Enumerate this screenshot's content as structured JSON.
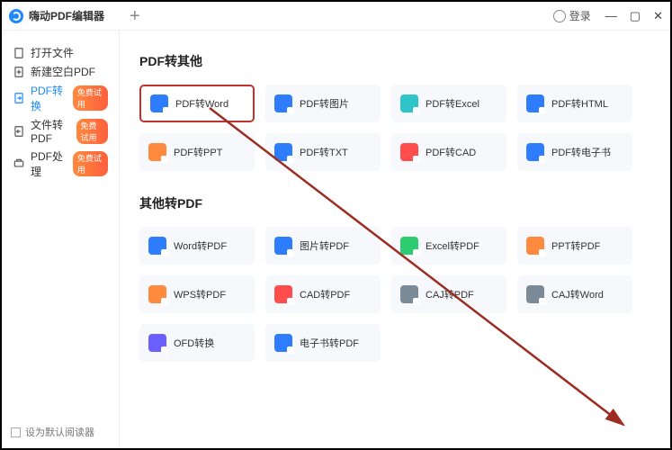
{
  "app": {
    "title": "嗨动PDF编辑器"
  },
  "titlebar": {
    "login": "登录"
  },
  "sidebar": {
    "items": [
      {
        "label": "打开文件",
        "active": false,
        "badge": ""
      },
      {
        "label": "新建空白PDF",
        "active": false,
        "badge": ""
      },
      {
        "label": "PDF转换",
        "active": true,
        "badge": "免费试用"
      },
      {
        "label": "文件转PDF",
        "active": false,
        "badge": "免费试用"
      },
      {
        "label": "PDF处理",
        "active": false,
        "badge": "免费试用"
      }
    ],
    "default_reader": "设为默认阅读器"
  },
  "sections": [
    {
      "title": "PDF转其他",
      "tools": [
        {
          "label": "PDF转Word",
          "color": "ic-blue",
          "highlighted": true
        },
        {
          "label": "PDF转图片",
          "color": "ic-blue"
        },
        {
          "label": "PDF转Excel",
          "color": "ic-cyan"
        },
        {
          "label": "PDF转HTML",
          "color": "ic-blue"
        },
        {
          "label": "PDF转PPT",
          "color": "ic-orange"
        },
        {
          "label": "PDF转TXT",
          "color": "ic-blue"
        },
        {
          "label": "PDF转CAD",
          "color": "ic-red"
        },
        {
          "label": "PDF转电子书",
          "color": "ic-blue"
        }
      ]
    },
    {
      "title": "其他转PDF",
      "tools": [
        {
          "label": "Word转PDF",
          "color": "ic-blue"
        },
        {
          "label": "图片转PDF",
          "color": "ic-blue"
        },
        {
          "label": "Excel转PDF",
          "color": "ic-green"
        },
        {
          "label": "PPT转PDF",
          "color": "ic-orange"
        },
        {
          "label": "WPS转PDF",
          "color": "ic-orange"
        },
        {
          "label": "CAD转PDF",
          "color": "ic-red"
        },
        {
          "label": "CAJ转PDF",
          "color": "ic-gray"
        },
        {
          "label": "CAJ转Word",
          "color": "ic-gray"
        },
        {
          "label": "OFD转换",
          "color": "ic-purple"
        },
        {
          "label": "电子书转PDF",
          "color": "ic-blue"
        }
      ]
    }
  ]
}
